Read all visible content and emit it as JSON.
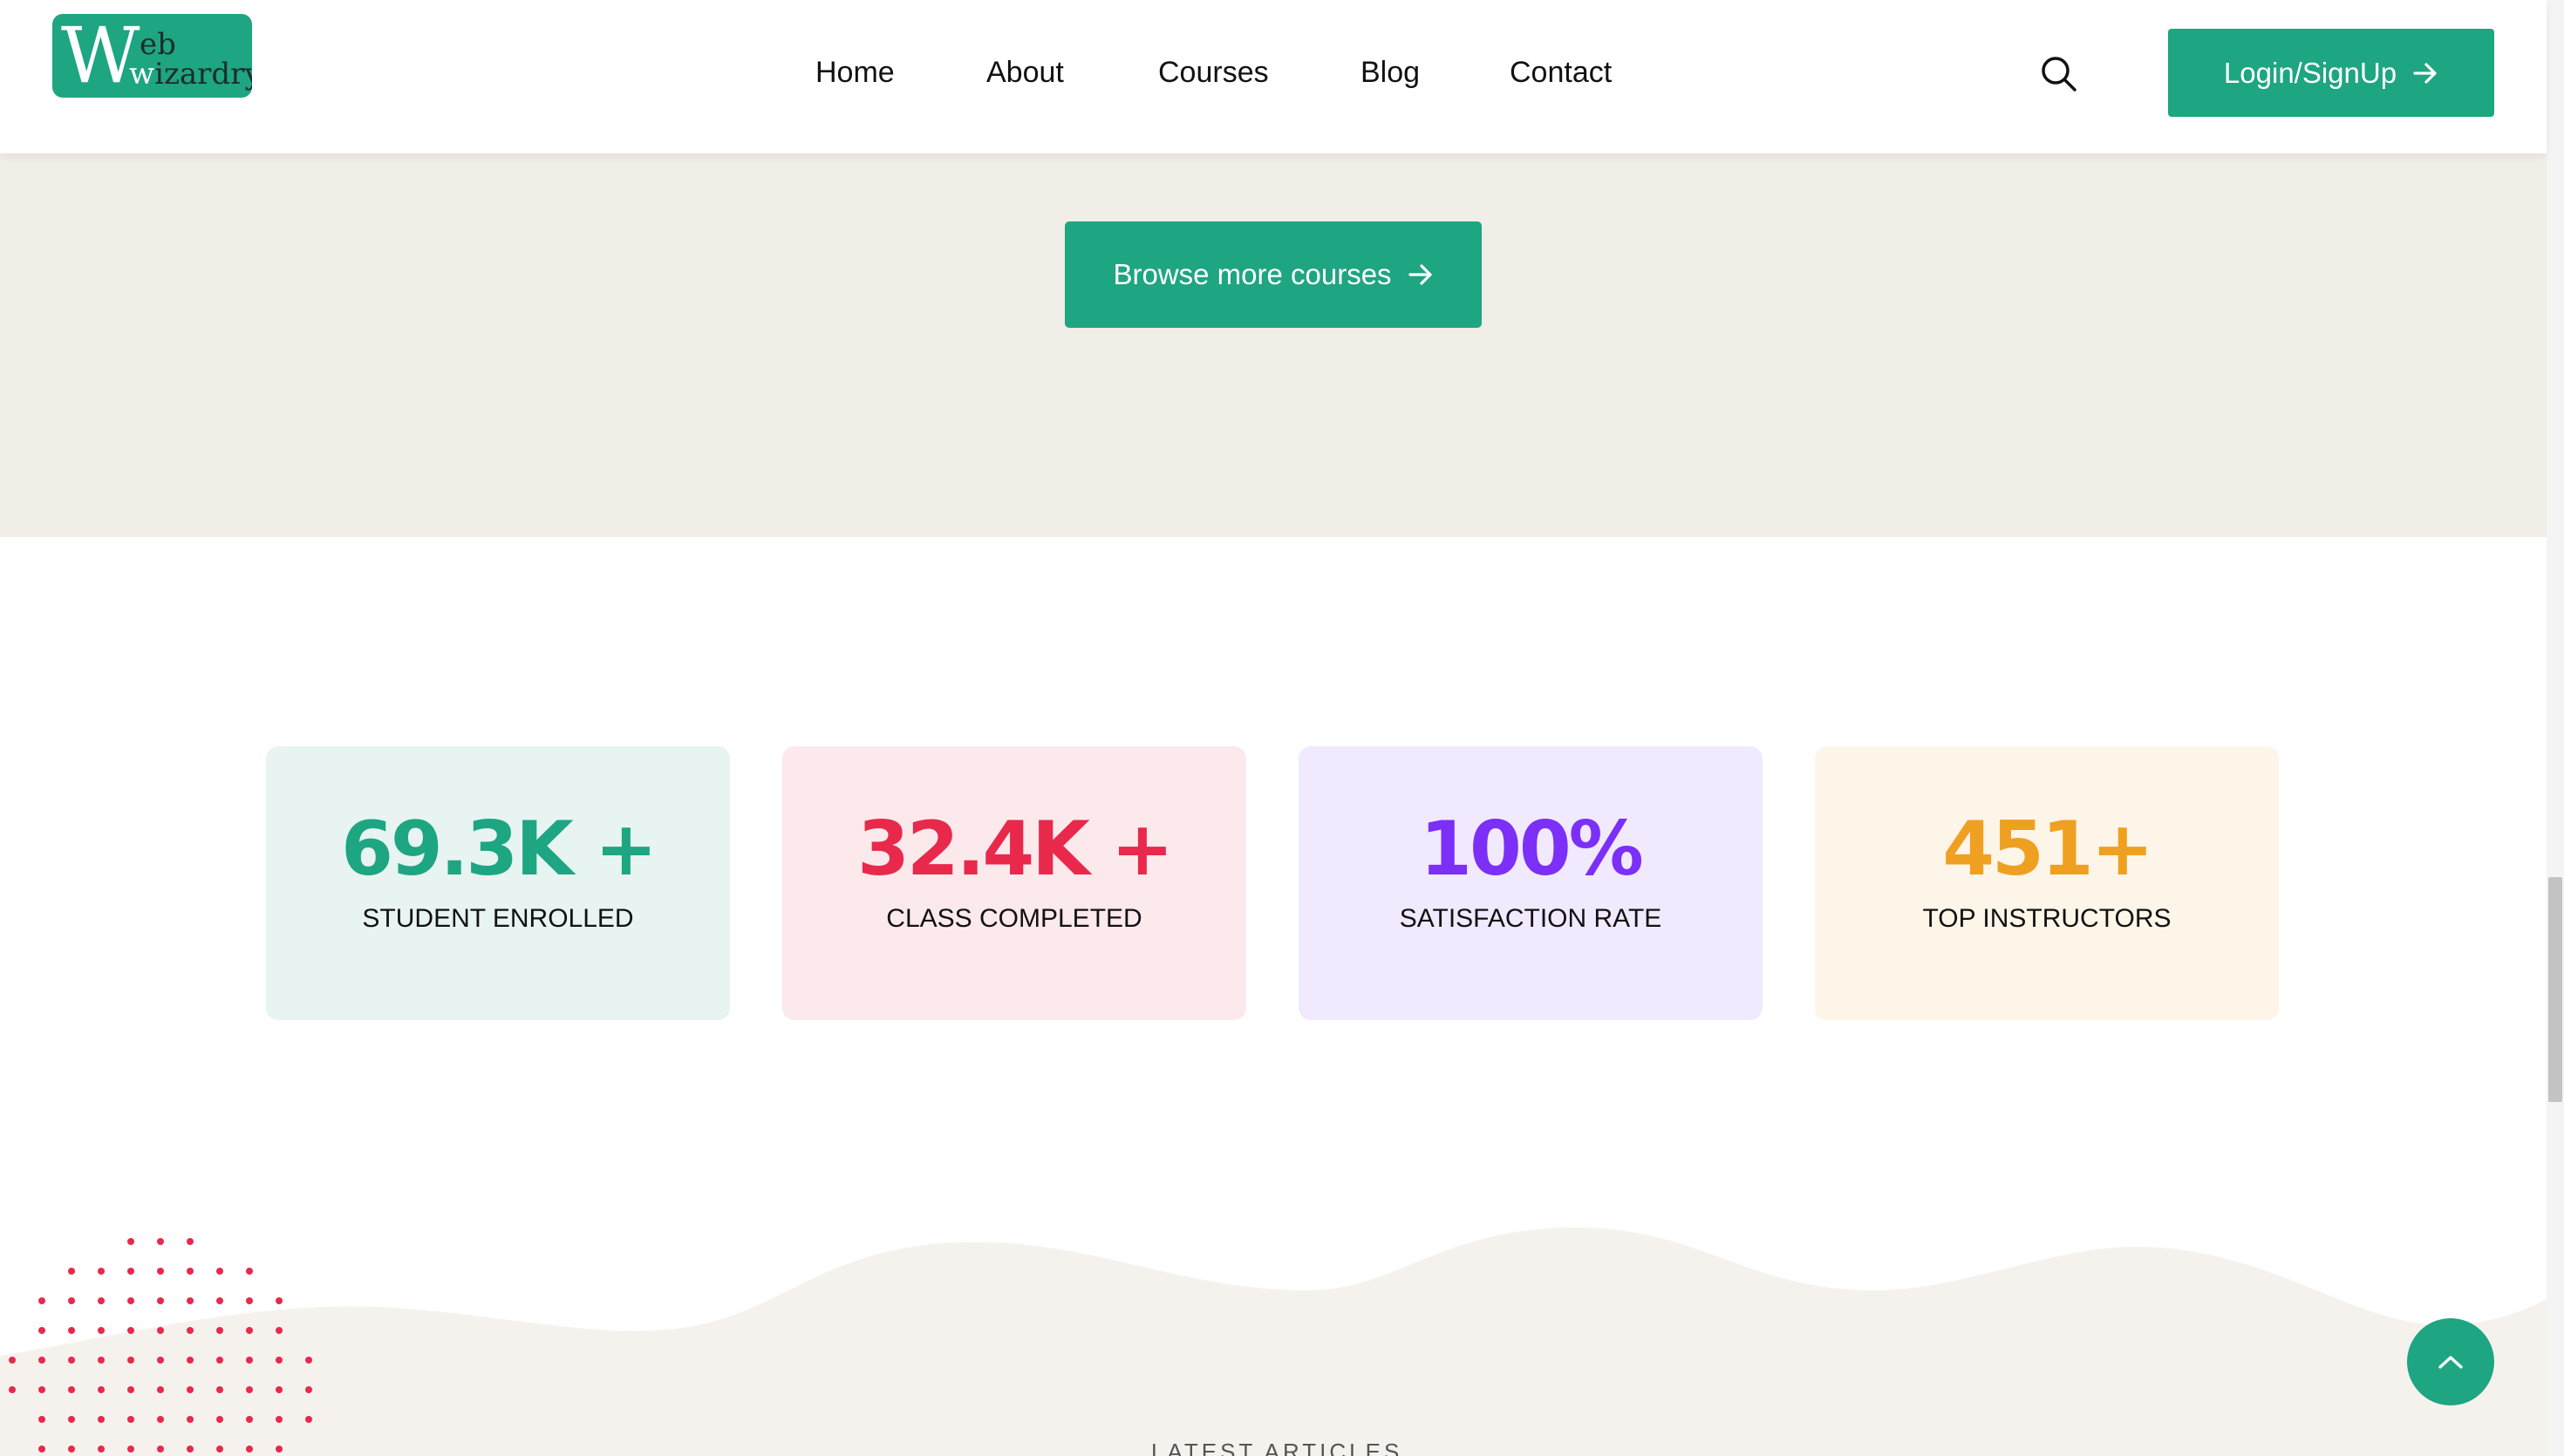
{
  "brand": {
    "logo_big_letter": "W",
    "logo_top": "eb",
    "logo_bottom_w": "w",
    "logo_bottom_rest": "izardry",
    "color": "#1ea582"
  },
  "nav": {
    "items": [
      {
        "label": "Home"
      },
      {
        "label": "About"
      },
      {
        "label": "Courses"
      },
      {
        "label": "Blog"
      },
      {
        "label": "Contact"
      }
    ],
    "search_icon": "search-icon",
    "login_label": "Login/SignUp"
  },
  "courses": {
    "browse_label": "Browse more courses"
  },
  "stats": [
    {
      "value": "69.3K +",
      "label": "STUDENT ENROLLED",
      "color": "#1ea582",
      "bg": "#e7f4f1"
    },
    {
      "value": "32.4K +",
      "label": "CLASS COMPLETED",
      "color": "#e8294c",
      "bg": "#fce9ec"
    },
    {
      "value": "100%",
      "label": "SATISFACTION RATE",
      "color": "#7b2ff7",
      "bg": "#f1e9fe"
    },
    {
      "value": "451+",
      "label": "TOP INSTRUCTORS",
      "color": "#f0a020",
      "bg": "#fdf5e8"
    }
  ],
  "articles": {
    "section_label": "LATEST ARTICLES"
  }
}
